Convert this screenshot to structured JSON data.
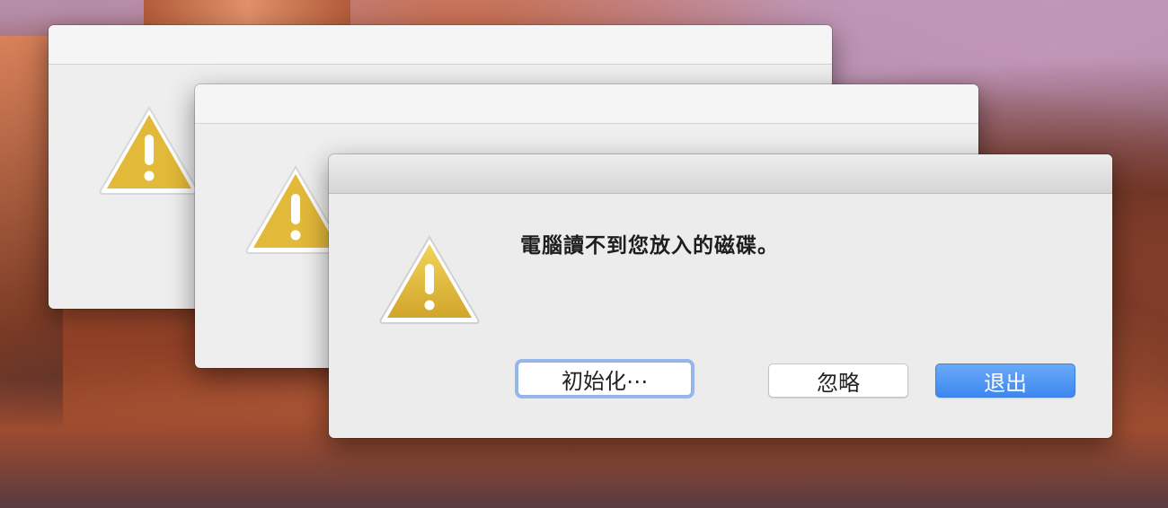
{
  "dialog": {
    "message": "電腦讀不到您放入的磁碟。",
    "buttons": {
      "initialize": "初始化⋯",
      "ignore": "忽略",
      "eject": "退出"
    }
  },
  "colors": {
    "warning_icon": "#e3b93a",
    "default_button": "#4a90f0",
    "focus_ring": "#7aa6ee"
  },
  "icons": [
    "warning-icon"
  ]
}
